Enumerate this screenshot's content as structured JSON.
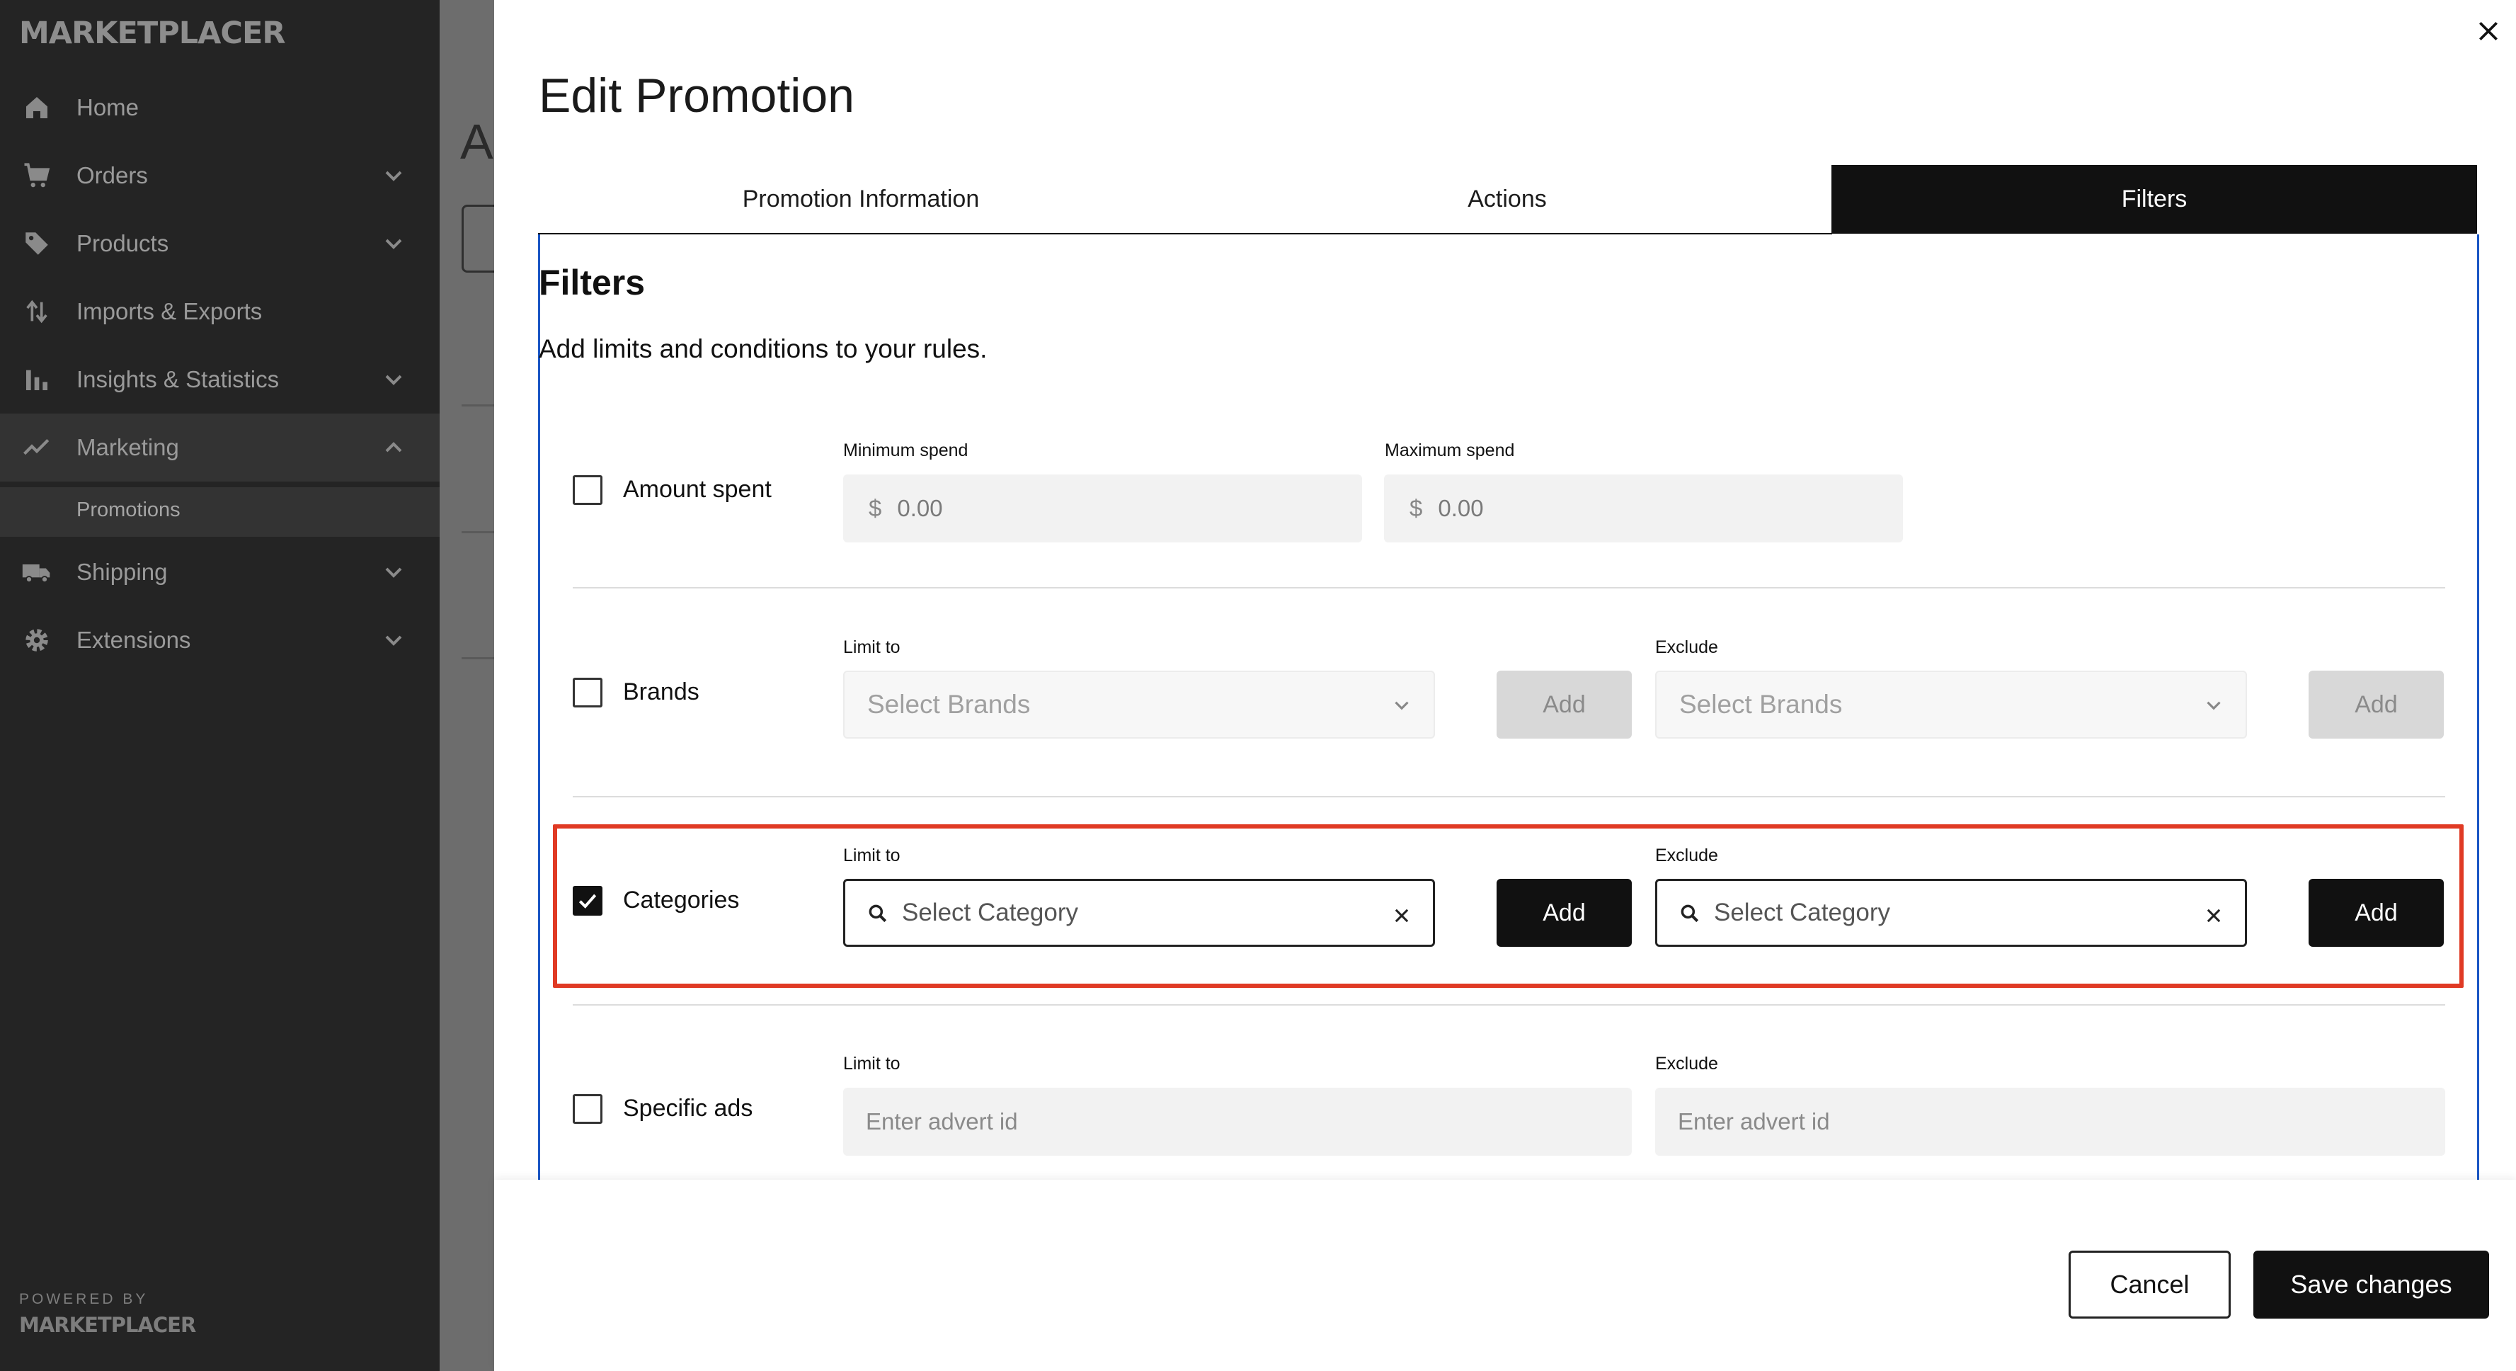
{
  "sidebar": {
    "logo": "MARKETPLACER",
    "items": [
      {
        "label": "Home",
        "icon": "home-icon"
      },
      {
        "label": "Orders",
        "icon": "cart-icon"
      },
      {
        "label": "Products",
        "icon": "tag-icon"
      },
      {
        "label": "Imports & Exports",
        "icon": "import-export-icon"
      },
      {
        "label": "Insights & Statistics",
        "icon": "bar-chart-icon"
      },
      {
        "label": "Marketing",
        "icon": "trend-icon"
      },
      {
        "label": "Shipping",
        "icon": "truck-icon"
      },
      {
        "label": "Extensions",
        "icon": "gear-icon"
      }
    ],
    "sub_item": "Promotions",
    "powered_by": "POWERED BY",
    "footer_logo": "MARKETPLACER"
  },
  "backdrop": {
    "title_fragment": "A"
  },
  "modal": {
    "title": "Edit Promotion",
    "tabs": [
      "Promotion Information",
      "Actions",
      "Filters"
    ],
    "active_tab": "Filters",
    "section_title": "Filters",
    "section_subtitle": "Add limits and conditions to your rules.",
    "amount": {
      "label": "Amount spent",
      "min_label": "Minimum spend",
      "max_label": "Maximum spend",
      "currency": "$",
      "min_value": "0.00",
      "max_value": "0.00",
      "checked": false
    },
    "brands": {
      "label": "Brands",
      "limit_label": "Limit to",
      "exclude_label": "Exclude",
      "placeholder": "Select Brands",
      "add_label": "Add",
      "checked": false
    },
    "categories": {
      "label": "Categories",
      "limit_label": "Limit to",
      "exclude_label": "Exclude",
      "placeholder": "Select Category",
      "add_label": "Add",
      "checked": true
    },
    "ads": {
      "label": "Specific ads",
      "limit_label": "Limit to",
      "exclude_label": "Exclude",
      "placeholder": "Enter advert id",
      "checked": false
    },
    "cancel_label": "Cancel",
    "save_label": "Save changes"
  },
  "colors": {
    "accent": "#111111",
    "highlight": "#e03a24",
    "panel_border": "#1a56c4"
  }
}
